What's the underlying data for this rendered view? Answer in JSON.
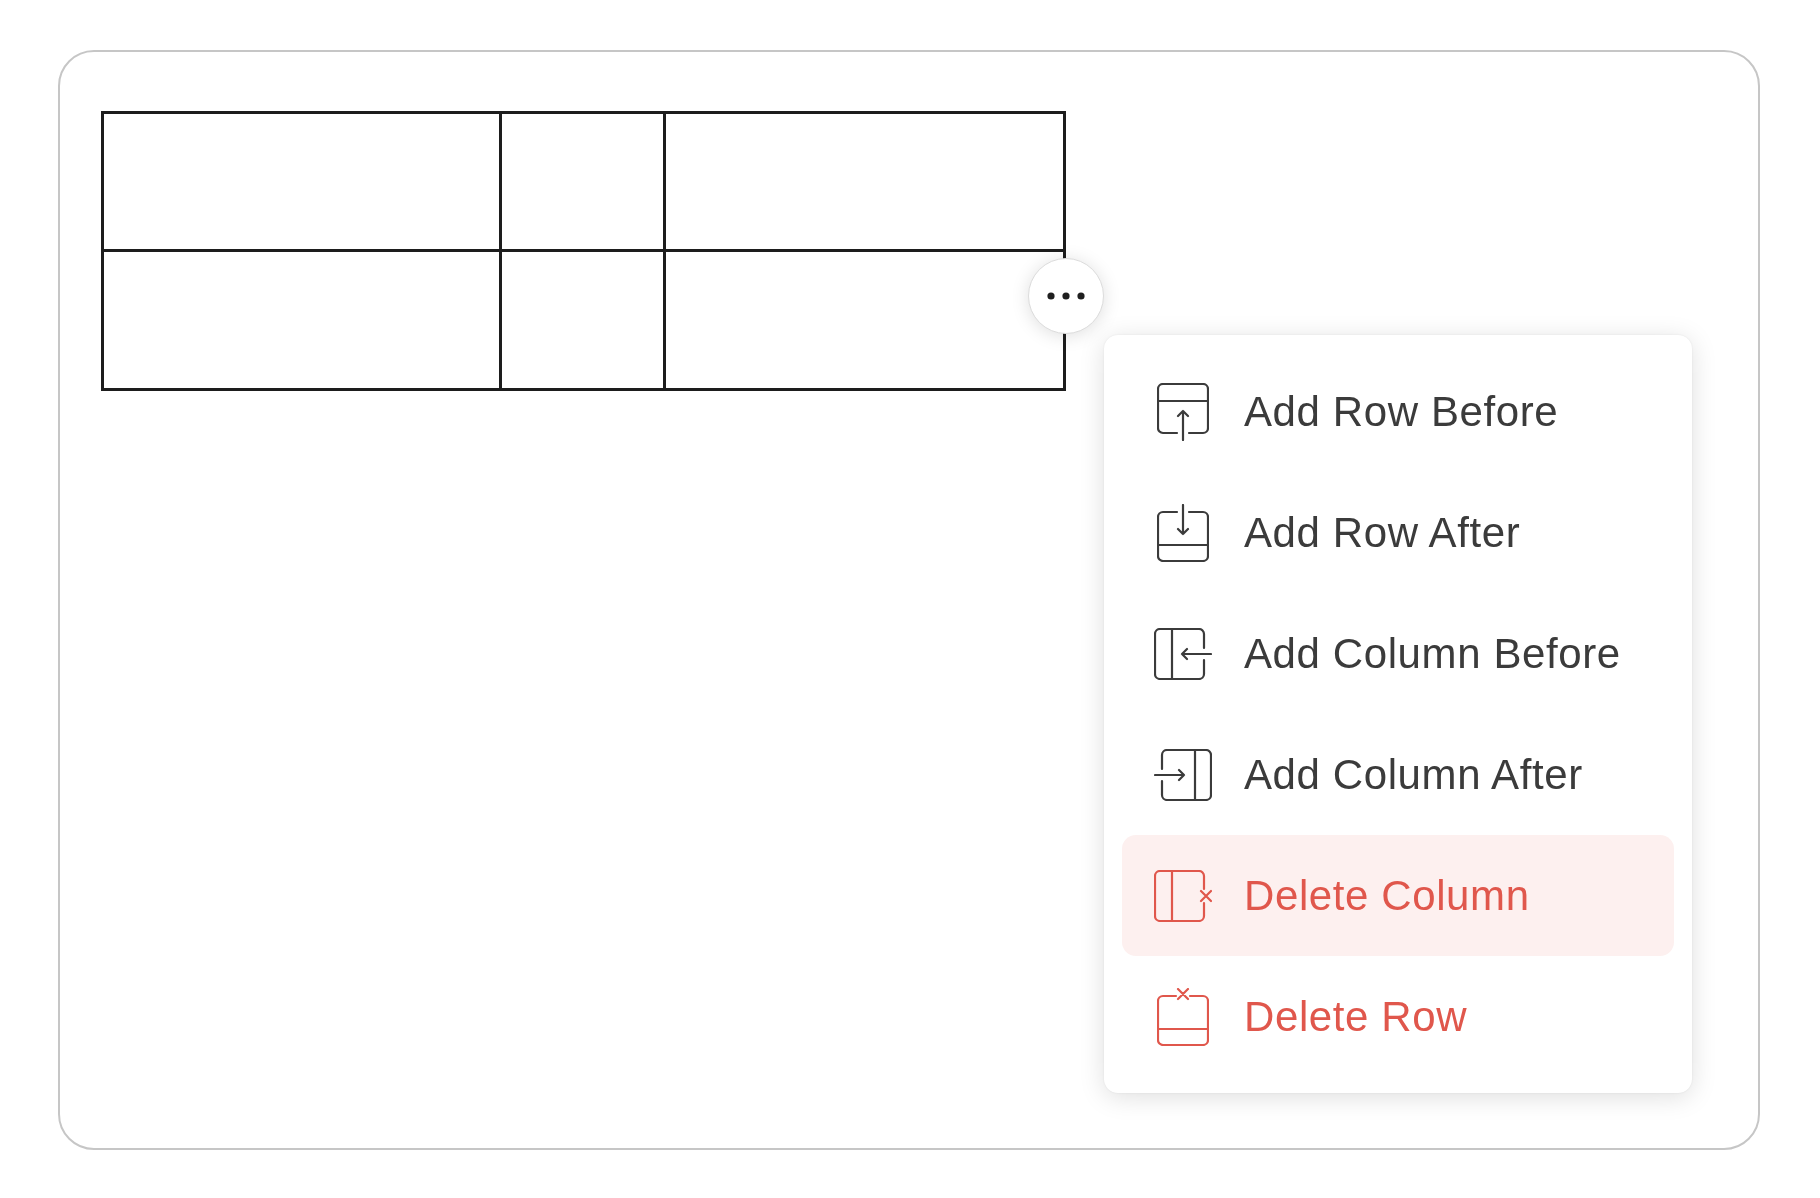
{
  "menu": {
    "items": [
      {
        "label": "Add Row Before",
        "kind": "rowbefore",
        "destructive": false,
        "selected": false
      },
      {
        "label": "Add Row After",
        "kind": "rowafter",
        "destructive": false,
        "selected": false
      },
      {
        "label": "Add Column Before",
        "kind": "colbefore",
        "destructive": false,
        "selected": false
      },
      {
        "label": "Add Column After",
        "kind": "colafter",
        "destructive": false,
        "selected": false
      },
      {
        "label": "Delete Column",
        "kind": "delcol",
        "destructive": true,
        "selected": true
      },
      {
        "label": "Delete Row",
        "kind": "delrow",
        "destructive": true,
        "selected": false
      }
    ]
  }
}
